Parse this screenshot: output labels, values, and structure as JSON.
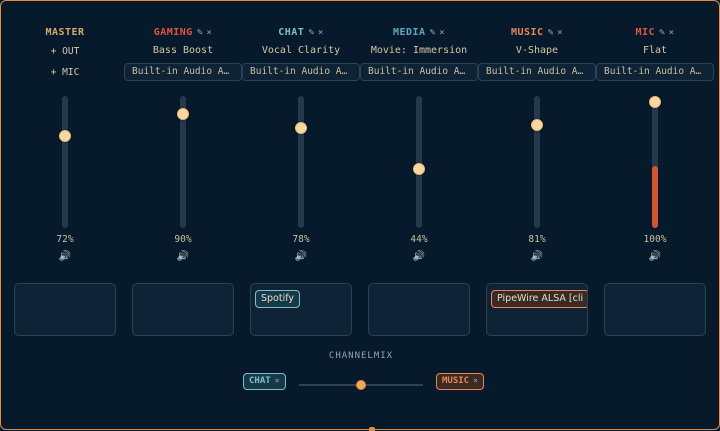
{
  "colors": {
    "bg": "#061a2b",
    "border_accent": "#e98a3a",
    "master": "#d9a86a",
    "gaming": "#e2553c",
    "chat": "#7fc0c4",
    "media": "#5ea8c0",
    "music": "#ef8552",
    "mic": "#e2553c",
    "knob": "#fad7a0"
  },
  "master": {
    "title": "MASTER",
    "out_label": "+ OUT",
    "mic_label": "+ MIC",
    "volume_text": "72%",
    "volume": 0.72,
    "speaker_icon": "speaker-icon"
  },
  "channels": [
    {
      "title": "GAMING",
      "preset": "Bass Boost",
      "device": "Built-in Audio A…",
      "volume_text": "90%",
      "volume": 0.9,
      "edit_icon": "✎",
      "close_icon": "×"
    },
    {
      "title": "CHAT",
      "preset": "Vocal Clarity",
      "device": "Built-in Audio A…",
      "volume_text": "78%",
      "volume": 0.78,
      "edit_icon": "✎",
      "close_icon": "×"
    },
    {
      "title": "MEDIA",
      "preset": "Movie: Immersion",
      "device": "Built-in Audio A…",
      "volume_text": "44%",
      "volume": 0.44,
      "edit_icon": "✎",
      "close_icon": "×"
    },
    {
      "title": "MUSIC",
      "preset": "V-Shape",
      "device": "Built-in Audio A…",
      "volume_text": "81%",
      "volume": 0.81,
      "edit_icon": "✎",
      "close_icon": "×"
    },
    {
      "title": "MIC",
      "preset": "Flat",
      "device": "Built-in Audio A…",
      "volume_text": "100%",
      "volume": 1.0,
      "edit_icon": "✎",
      "close_icon": "×"
    }
  ],
  "apps": {
    "chat": "Spotify",
    "music": "PipeWire ALSA [cli"
  },
  "channelmix": {
    "label": "CHANNELMIX",
    "left": "CHAT",
    "right": "MUSIC",
    "close_icon": "×",
    "balance": 0.5
  }
}
